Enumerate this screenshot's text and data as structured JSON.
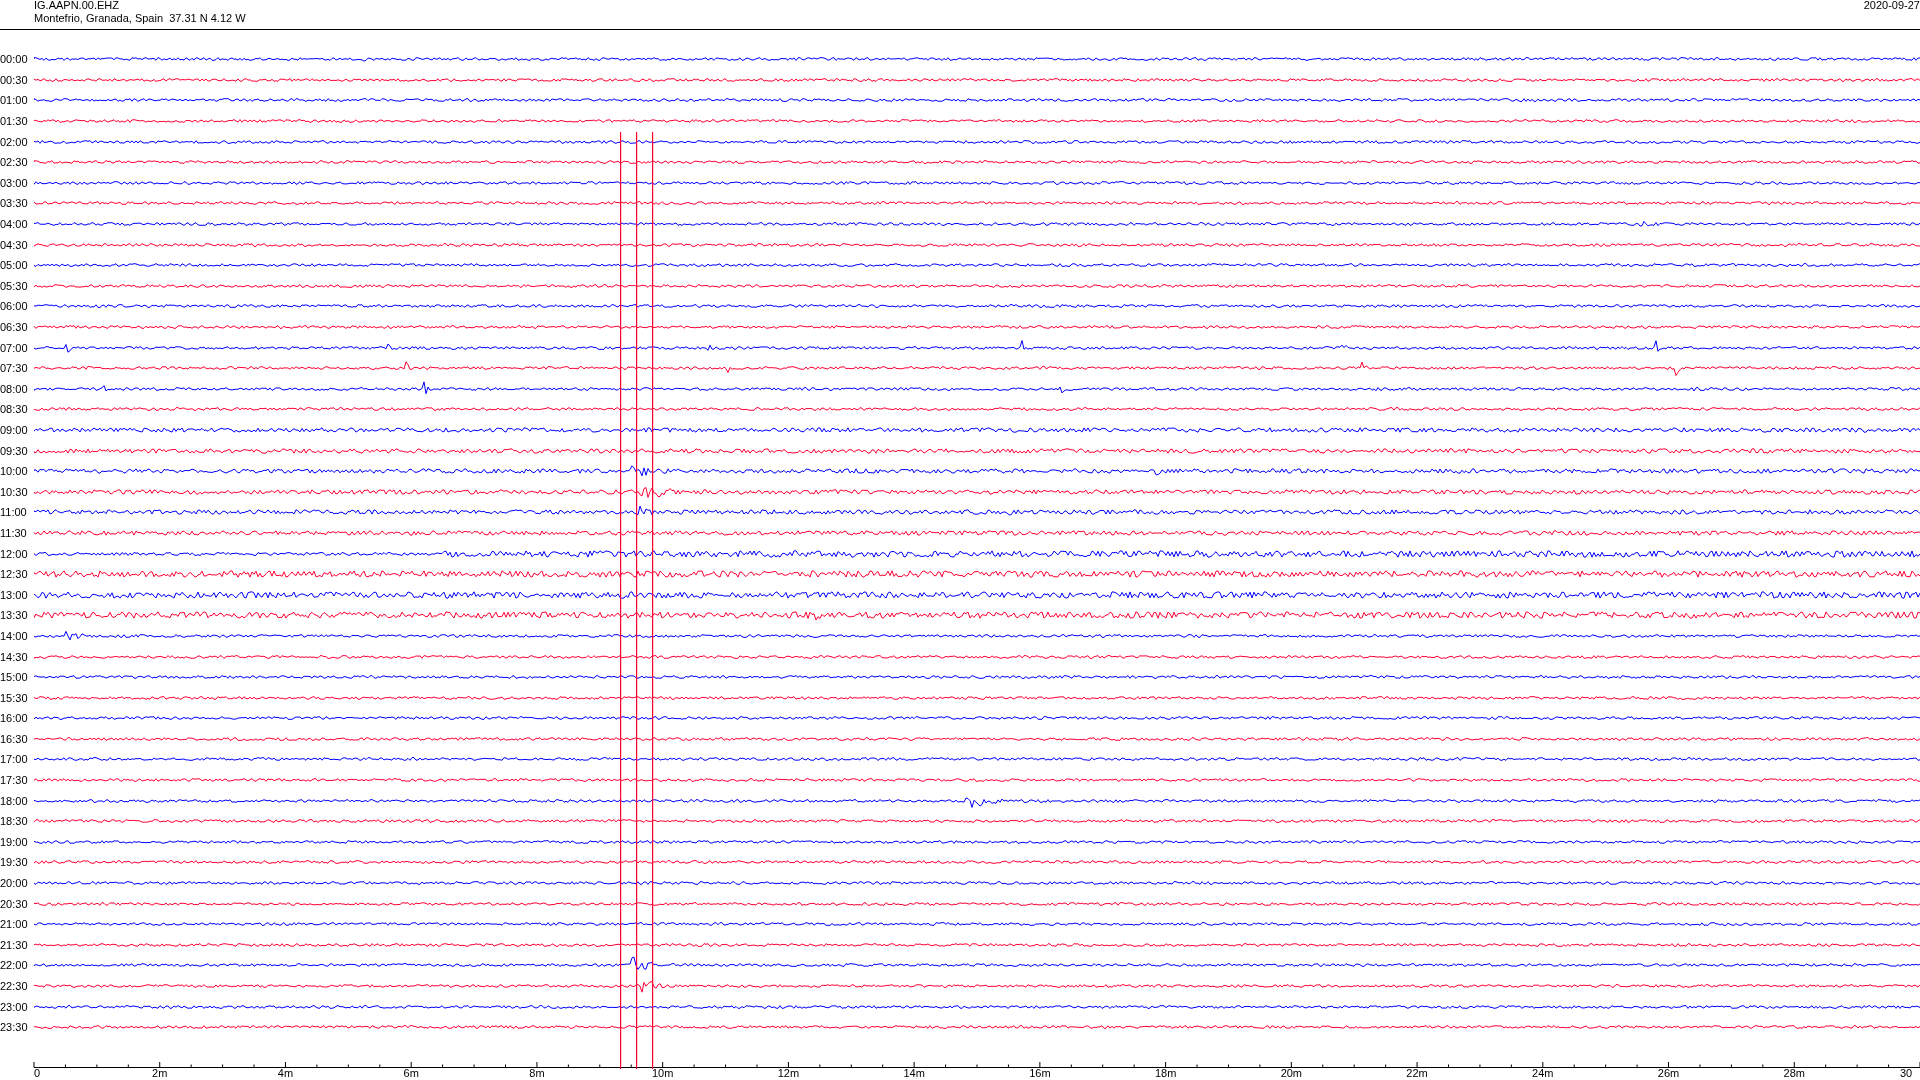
{
  "header": {
    "station": "IG.AAPN.00.EHZ",
    "location": "Montefrio, Granada, Spain  37.31 N 4.12 W",
    "date": "2020-09-27"
  },
  "traces": [
    {
      "time": "00:00",
      "color": "#0000ff"
    },
    {
      "time": "00:30",
      "color": "#ff0033"
    },
    {
      "time": "01:00",
      "color": "#0000ff"
    },
    {
      "time": "01:30",
      "color": "#ff0033"
    },
    {
      "time": "02:00",
      "color": "#0000ff"
    },
    {
      "time": "02:30",
      "color": "#ff0033"
    },
    {
      "time": "03:00",
      "color": "#0000ff"
    },
    {
      "time": "03:30",
      "color": "#ff0033"
    },
    {
      "time": "04:00",
      "color": "#0000ff"
    },
    {
      "time": "04:30",
      "color": "#ff0033"
    },
    {
      "time": "05:00",
      "color": "#0000ff"
    },
    {
      "time": "05:30",
      "color": "#ff0033"
    },
    {
      "time": "06:00",
      "color": "#0000ff"
    },
    {
      "time": "06:30",
      "color": "#ff0033"
    },
    {
      "time": "07:00",
      "color": "#0000ff"
    },
    {
      "time": "07:30",
      "color": "#ff0033"
    },
    {
      "time": "08:00",
      "color": "#0000ff"
    },
    {
      "time": "08:30",
      "color": "#ff0033"
    },
    {
      "time": "09:00",
      "color": "#0000ff"
    },
    {
      "time": "09:30",
      "color": "#ff0033"
    },
    {
      "time": "10:00",
      "color": "#0000ff"
    },
    {
      "time": "10:30",
      "color": "#ff0033"
    },
    {
      "time": "11:00",
      "color": "#0000ff"
    },
    {
      "time": "11:30",
      "color": "#ff0033"
    },
    {
      "time": "12:00",
      "color": "#0000ff"
    },
    {
      "time": "12:30",
      "color": "#ff0033"
    },
    {
      "time": "13:00",
      "color": "#0000ff"
    },
    {
      "time": "13:30",
      "color": "#ff0033"
    },
    {
      "time": "14:00",
      "color": "#0000ff"
    },
    {
      "time": "14:30",
      "color": "#ff0033"
    },
    {
      "time": "15:00",
      "color": "#0000ff"
    },
    {
      "time": "15:30",
      "color": "#ff0033"
    },
    {
      "time": "16:00",
      "color": "#0000ff"
    },
    {
      "time": "16:30",
      "color": "#ff0033"
    },
    {
      "time": "17:00",
      "color": "#0000ff"
    },
    {
      "time": "17:30",
      "color": "#ff0033"
    },
    {
      "time": "18:00",
      "color": "#0000ff"
    },
    {
      "time": "18:30",
      "color": "#ff0033"
    },
    {
      "time": "19:00",
      "color": "#0000ff"
    },
    {
      "time": "19:30",
      "color": "#ff0033"
    },
    {
      "time": "20:00",
      "color": "#0000ff"
    },
    {
      "time": "20:30",
      "color": "#ff0033"
    },
    {
      "time": "21:00",
      "color": "#0000ff"
    },
    {
      "time": "21:30",
      "color": "#ff0033"
    },
    {
      "time": "22:00",
      "color": "#0000ff"
    },
    {
      "time": "22:30",
      "color": "#ff0033"
    },
    {
      "time": "23:00",
      "color": "#0000ff"
    },
    {
      "time": "23:30",
      "color": "#ff0033"
    }
  ],
  "x_axis": {
    "ticks": [
      "0",
      "2m",
      "4m",
      "6m",
      "8m",
      "10m",
      "12m",
      "14m",
      "16m",
      "18m",
      "20m",
      "22m",
      "24m",
      "26m",
      "28m",
      "30"
    ]
  }
}
